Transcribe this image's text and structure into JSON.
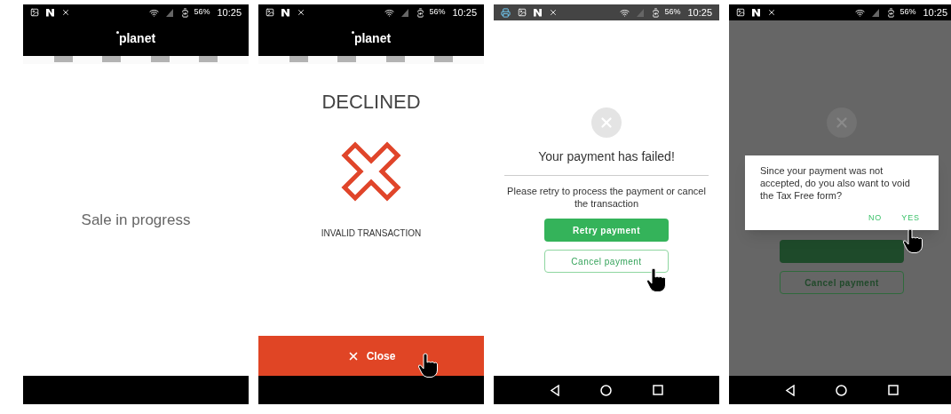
{
  "screens": [
    {
      "kind": "sale",
      "status_bar": {
        "printer": false,
        "battery": "56%",
        "time": "10:25"
      },
      "header": {
        "logo": "planet"
      },
      "message": "Sale in progress",
      "tap_cursor": false
    },
    {
      "kind": "declined",
      "status_bar": {
        "printer": false,
        "battery": "56%",
        "time": "10:25"
      },
      "header": {
        "logo": "planet"
      },
      "title": "DECLINED",
      "reason": "INVALID TRANSACTION",
      "close_button": "Close",
      "tap_cursor": true
    },
    {
      "kind": "failed",
      "status_bar": {
        "printer": true,
        "battery": "56%",
        "time": "10:25"
      },
      "title": "Your payment has failed!",
      "message": "Please retry to process the payment or cancel the transaction",
      "retry_button": "Retry payment",
      "cancel_button": "Cancel payment",
      "tap_cursor": true
    },
    {
      "kind": "void_dialog",
      "status_bar": {
        "printer": false,
        "battery": "56%",
        "time": "10:25"
      },
      "cancel_button": "Cancel payment",
      "dialog": {
        "message": "Since your payment was not accepted, do you also want to void the Tax Free form?",
        "buttons": [
          "NO",
          "YES"
        ]
      },
      "tap_cursor": true
    }
  ]
}
